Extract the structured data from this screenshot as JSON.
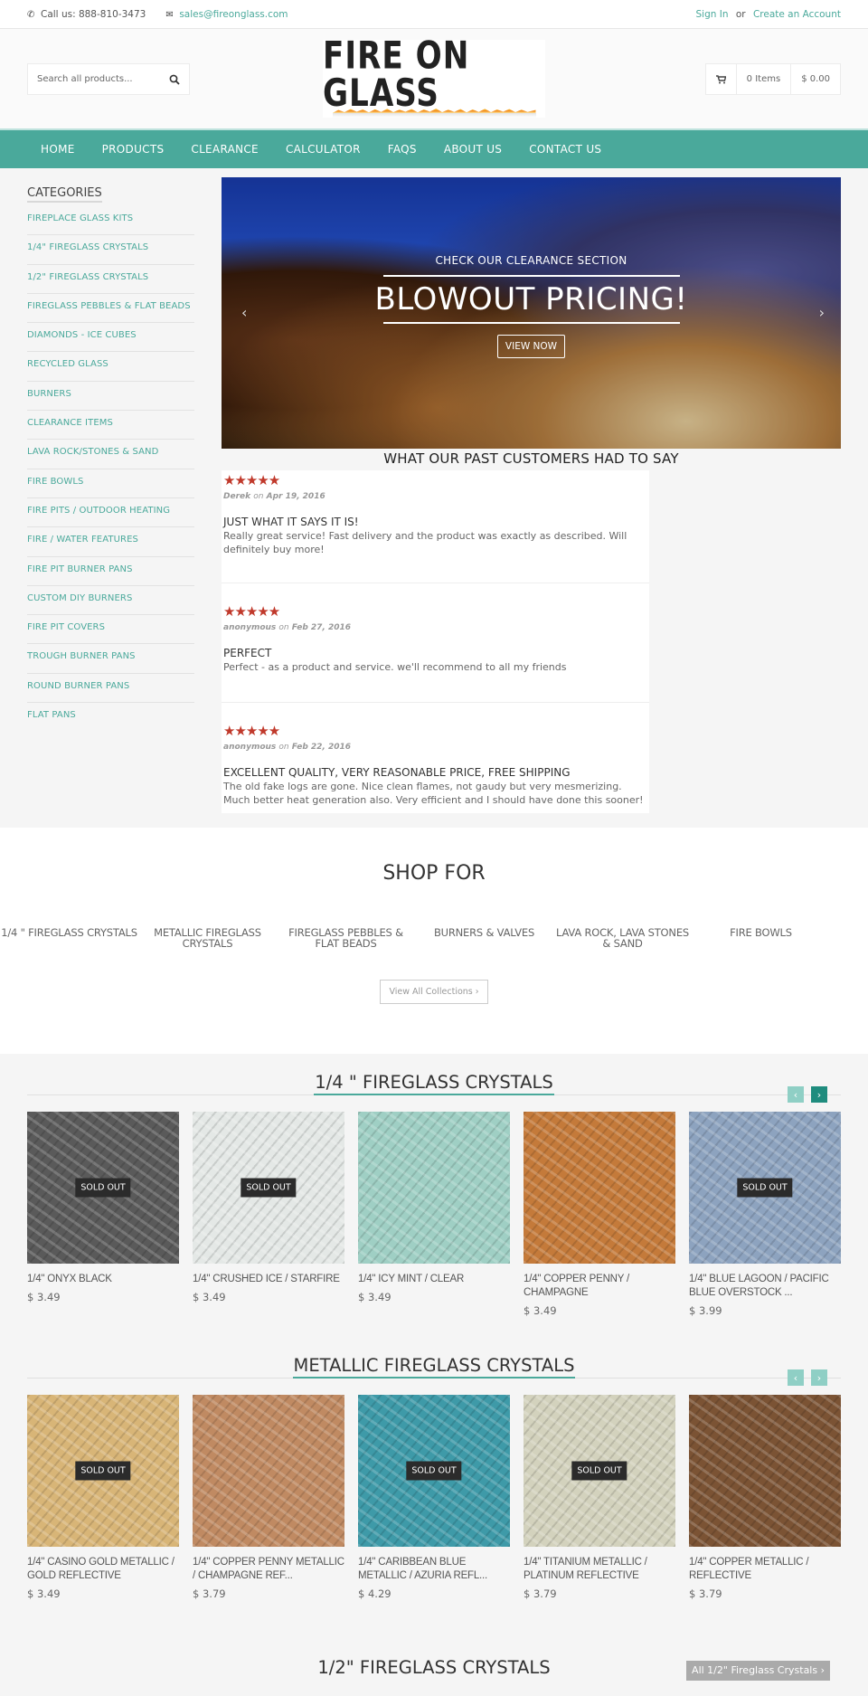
{
  "topbar": {
    "phone_icon": "phone-icon",
    "phone": "Call us: 888-810-3473",
    "email_icon": "envelope-icon",
    "email": "sales@fireonglass.com",
    "sign_in": "Sign In",
    "or": "or",
    "create_account": "Create an Account"
  },
  "header": {
    "search_placeholder": "Search all products...",
    "logo_text": "FIRE ON GLASS",
    "cart_items": "0 Items",
    "cart_total": "$ 0.00"
  },
  "nav": [
    "HOME",
    "PRODUCTS",
    "CLEARANCE",
    "CALCULATOR",
    "FAQS",
    "ABOUT US",
    "CONTACT US"
  ],
  "sidebar": {
    "title": "CATEGORIES",
    "items": [
      "FIREPLACE GLASS KITS",
      "1/4\" FIREGLASS CRYSTALS",
      "1/2\" FIREGLASS CRYSTALS",
      "FIREGLASS PEBBLES & FLAT BEADS",
      "DIAMONDS - ICE CUBES",
      "RECYCLED GLASS",
      "BURNERS",
      "CLEARANCE ITEMS",
      "LAVA ROCK/STONES & SAND",
      "FIRE BOWLS",
      "FIRE PITS / OUTDOOR HEATING",
      "FIRE / WATER FEATURES",
      "FIRE PIT BURNER PANS",
      "CUSTOM DIY BURNERS",
      "FIRE PIT COVERS",
      "TROUGH BURNER PANS",
      "ROUND BURNER PANS",
      "FLAT PANS"
    ]
  },
  "hero": {
    "subtitle": "CHECK OUR CLEARANCE SECTION",
    "title": "BLOWOUT PRICING!",
    "button": "VIEW NOW",
    "prev": "‹",
    "next": "›"
  },
  "reviews": {
    "title": "WHAT OUR PAST CUSTOMERS HAD TO SAY",
    "on": "on",
    "items": [
      {
        "stars": 5,
        "star_text": "★★★★★",
        "author": "Derek",
        "date": "Apr 19, 2016",
        "title": "JUST WHAT IT SAYS IT IS!",
        "body": "Really great service! Fast delivery and the product was exactly as described. Will definitely buy more!"
      },
      {
        "stars": 5,
        "star_text": "★★★★★",
        "author": "anonymous",
        "date": "Feb 27, 2016",
        "title": "PERFECT",
        "body": "Perfect - as a product and service. we'll recommend to all my friends"
      },
      {
        "stars": 5,
        "star_text": "★★★★★",
        "author": "anonymous",
        "date": "Feb 22, 2016",
        "title": "EXCELLENT QUALITY, VERY REASONABLE PRICE, FREE SHIPPING",
        "body": "The old fake logs are gone. Nice clean flames, not gaudy but very mesmerizing. Much better heat generation also. Very efficient and I should have done this sooner!"
      }
    ]
  },
  "shopfor": {
    "title": "SHOP FOR",
    "items": [
      "1/4 \" FIREGLASS CRYSTALS",
      "METALLIC FIREGLASS CRYSTALS",
      "FIREGLASS PEBBLES & FLAT BEADS",
      "BURNERS & VALVES",
      "LAVA ROCK, LAVA STONES & SAND",
      "FIRE BOWLS"
    ],
    "view_all": "View All Collections ›"
  },
  "sections": [
    {
      "title": "1/4 \" FIREGLASS CRYSTALS",
      "prev": "‹",
      "next": "›",
      "products": [
        {
          "name": "1/4\" ONYX BLACK",
          "price": "$ 3.49",
          "sold_out": true,
          "color": "#5a5a5a"
        },
        {
          "name": "1/4\" CRUSHED ICE / STARFIRE",
          "price": "$ 3.49",
          "sold_out": true,
          "color": "#e4e8e6"
        },
        {
          "name": "1/4\" ICY MINT / CLEAR",
          "price": "$ 3.49",
          "sold_out": false,
          "color": "#9fcfc4"
        },
        {
          "name": "1/4\" COPPER PENNY / CHAMPAGNE",
          "price": "$ 3.49",
          "sold_out": false,
          "color": "#c47a3a"
        },
        {
          "name": "1/4\" BLUE LAGOON / PACIFIC BLUE OVERSTOCK ...",
          "price": "$ 3.99",
          "sold_out": true,
          "color": "#8da3bf"
        }
      ]
    },
    {
      "title": "METALLIC FIREGLASS CRYSTALS",
      "prev": "‹",
      "next": "›",
      "products": [
        {
          "name": "1/4\" CASINO GOLD METALLIC / GOLD REFLECTIVE",
          "price": "$ 3.49",
          "sold_out": true,
          "color": "#d8b577"
        },
        {
          "name": "1/4\" COPPER PENNY METALLIC / CHAMPAGNE REF...",
          "price": "$ 3.79",
          "sold_out": false,
          "color": "#c08a62"
        },
        {
          "name": "1/4\" CARIBBEAN BLUE METALLIC / AZURIA REFL...",
          "price": "$ 4.29",
          "sold_out": true,
          "color": "#3e9aa8"
        },
        {
          "name": "1/4\" TITANIUM METALLIC / PLATINUM REFLECTIVE",
          "price": "$ 3.79",
          "sold_out": true,
          "color": "#d3d2bd"
        },
        {
          "name": "1/4\" COPPER METALLIC / REFLECTIVE",
          "price": "$ 3.79",
          "sold_out": false,
          "color": "#7b5334"
        }
      ]
    }
  ],
  "half_section": {
    "title": "1/2\" FIREGLASS CRYSTALS",
    "button": "All 1/2\" Fireglass Crystals ›"
  },
  "sold_out_label": "SOLD OUT",
  "colors": {
    "accent": "#4aa99b",
    "star": "#c0392b"
  }
}
